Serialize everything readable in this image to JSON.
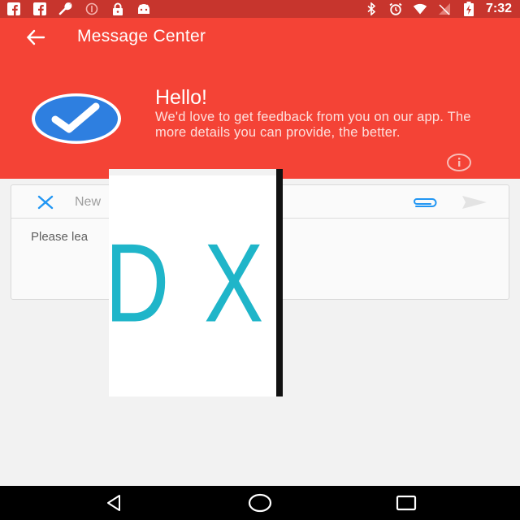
{
  "status_bar": {
    "time": "7:32",
    "left_icons": [
      "facebook-icon",
      "facebook-icon",
      "wrench-icon",
      "blocked-icon",
      "lock-icon",
      "android-icon"
    ],
    "right_icons": [
      "bluetooth-icon",
      "alarm-icon",
      "wifi-icon",
      "no-signal-icon",
      "battery-charging-icon"
    ]
  },
  "app_bar": {
    "title": "Message Center",
    "back_icon": "arrow-back-icon"
  },
  "header": {
    "greeting": "Hello!",
    "body": "We'd love to get feedback from you on our app. The more details you can provide, the better.",
    "badge_icon": "checkmark-icon",
    "info_icon": "info-icon"
  },
  "composer": {
    "title_visible": "New",
    "body_visible": "Please lea",
    "close_icon": "close-icon",
    "attach_icon": "paperclip-icon",
    "send_icon": "send-icon"
  },
  "overlay": {
    "text": "D X"
  },
  "nav_bar": {
    "icons": [
      "back-triangle-icon",
      "home-circle-icon",
      "recents-square-icon"
    ]
  },
  "colors": {
    "primary": "#f44336",
    "status_bar": "#c7352d",
    "accent_blue": "#2196f3",
    "overlay_teal": "#1fb5c9"
  }
}
